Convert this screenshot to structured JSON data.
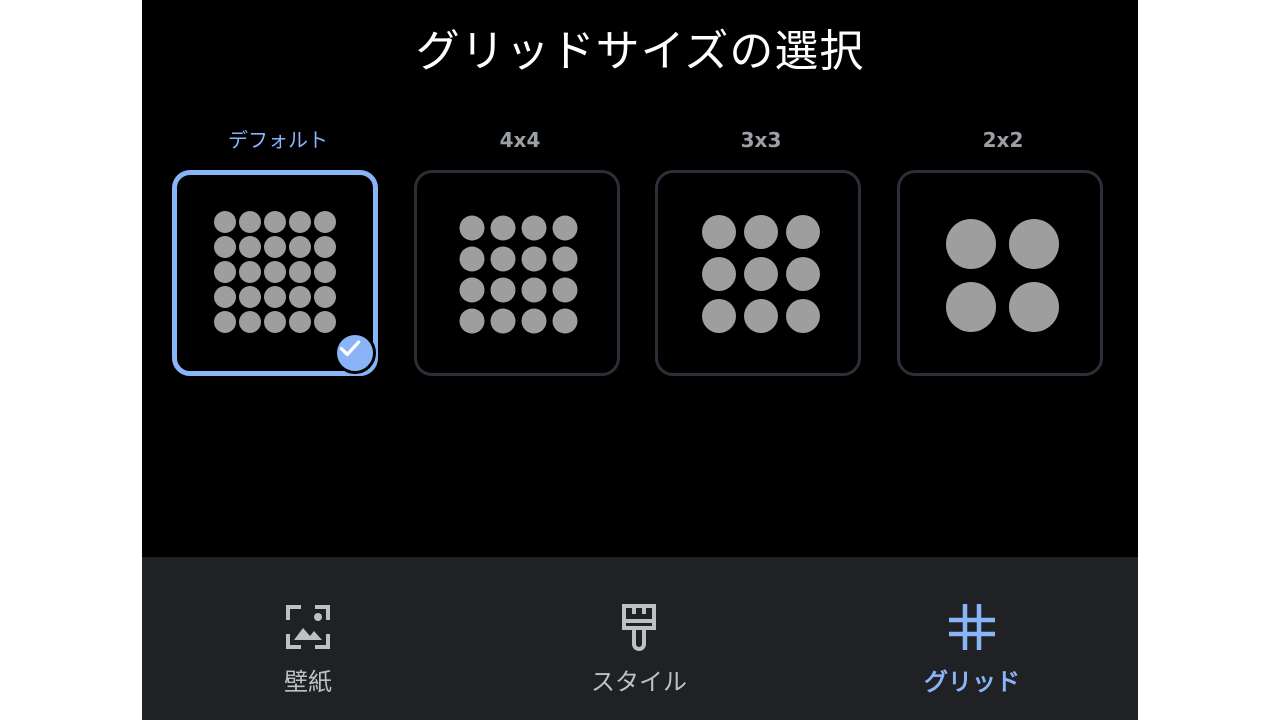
{
  "page_title": "グリッドサイズの選択",
  "grid_options": [
    {
      "label": "デフォルト",
      "columns": 5,
      "rows": 5,
      "selected": true
    },
    {
      "label": "4x4",
      "columns": 4,
      "rows": 4,
      "selected": false
    },
    {
      "label": "3x3",
      "columns": 3,
      "rows": 3,
      "selected": false
    },
    {
      "label": "2x2",
      "columns": 2,
      "rows": 2,
      "selected": false
    }
  ],
  "bottom_nav": {
    "items": [
      {
        "label": "壁紙",
        "icon": "wallpaper-icon",
        "active": false
      },
      {
        "label": "スタイル",
        "icon": "paintbrush-icon",
        "active": false
      },
      {
        "label": "グリッド",
        "icon": "grid-icon",
        "active": true
      }
    ]
  },
  "colors": {
    "accent": "#8ab4f8",
    "background": "#000000",
    "nav_background": "#202124",
    "tile_border": "#2a2f38",
    "dot": "#9e9e9e"
  }
}
